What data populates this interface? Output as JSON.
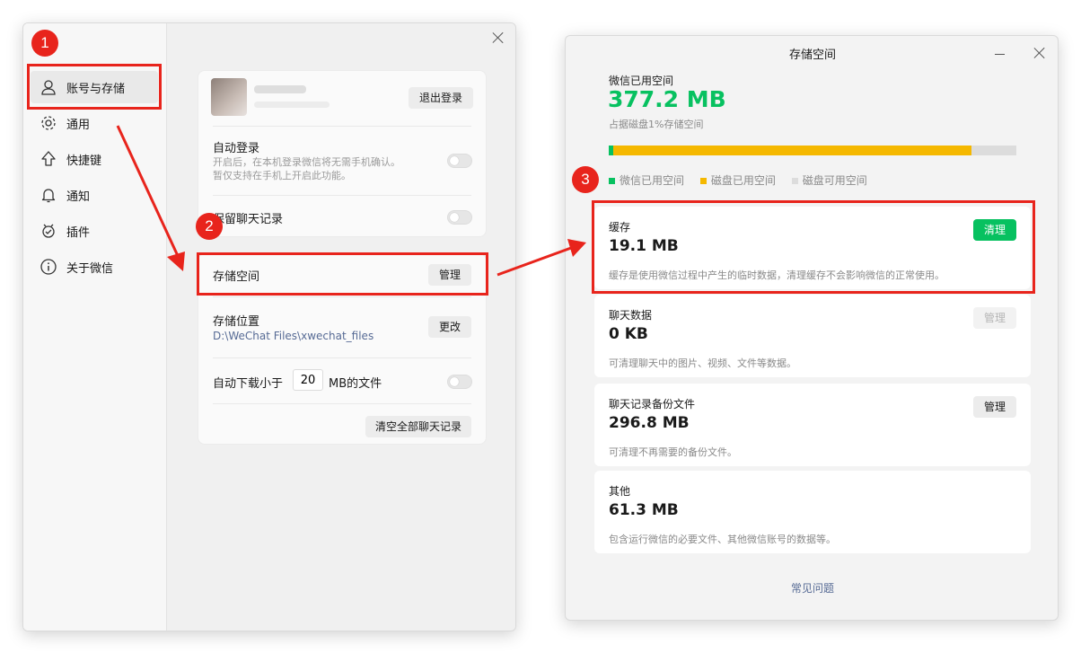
{
  "annotations": {
    "step1": "1",
    "step2": "2",
    "step3": "3"
  },
  "colors": {
    "accent_green": "#07c160",
    "bar_yellow": "#f5b800",
    "bar_grey": "#dcdcdc",
    "annotation_red": "#e8241c",
    "link_blue": "#576b95"
  },
  "settings_window": {
    "sidebar": [
      {
        "label": "账号与存储",
        "icon": "user-icon"
      },
      {
        "label": "通用",
        "icon": "gear-icon"
      },
      {
        "label": "快捷键",
        "icon": "arrow-up-icon"
      },
      {
        "label": "通知",
        "icon": "bell-icon"
      },
      {
        "label": "插件",
        "icon": "plugin-icon"
      },
      {
        "label": "关于微信",
        "icon": "info-icon"
      }
    ],
    "account": {
      "logout_label": "退出登录"
    },
    "auto_login": {
      "title": "自动登录",
      "desc_line1": "开启后，在本机登录微信将无需手机确认。",
      "desc_line2": "暂仅支持在手机上开启此功能。"
    },
    "keep_history": {
      "title": "保留聊天记录"
    },
    "storage_space": {
      "title": "存储空间",
      "button": "管理"
    },
    "storage_location": {
      "title": "存储位置",
      "path": "D:\\WeChat Files\\xwechat_files",
      "button": "更改"
    },
    "auto_download": {
      "prefix": "自动下载小于",
      "value": "20",
      "suffix": "MB的文件"
    },
    "clear_all_label": "清空全部聊天记录"
  },
  "storage_window": {
    "title": "存储空间",
    "used_label": "微信已用空间",
    "used_size": "377.2 MB",
    "disk_ratio": "占据磁盘1%存储空间",
    "bar": {
      "wechat_used_fraction": 0.01,
      "disk_used_fraction": 0.89
    },
    "legend": [
      "微信已用空间",
      "磁盘已用空间",
      "磁盘可用空间"
    ],
    "cards": [
      {
        "label": "缓存",
        "size": "19.1 MB",
        "desc": "缓存是使用微信过程中产生的临时数据，清理缓存不会影响微信的正常使用。",
        "button": "清理"
      },
      {
        "label": "聊天数据",
        "size": "0 KB",
        "desc": "可清理聊天中的图片、视频、文件等数据。",
        "button": "管理"
      },
      {
        "label": "聊天记录备份文件",
        "size": "296.8 MB",
        "desc": "可清理不再需要的备份文件。",
        "button": "管理"
      },
      {
        "label": "其他",
        "size": "61.3 MB",
        "desc": "包含运行微信的必要文件、其他微信账号的数据等。"
      }
    ],
    "faq_link": "常见问题"
  }
}
